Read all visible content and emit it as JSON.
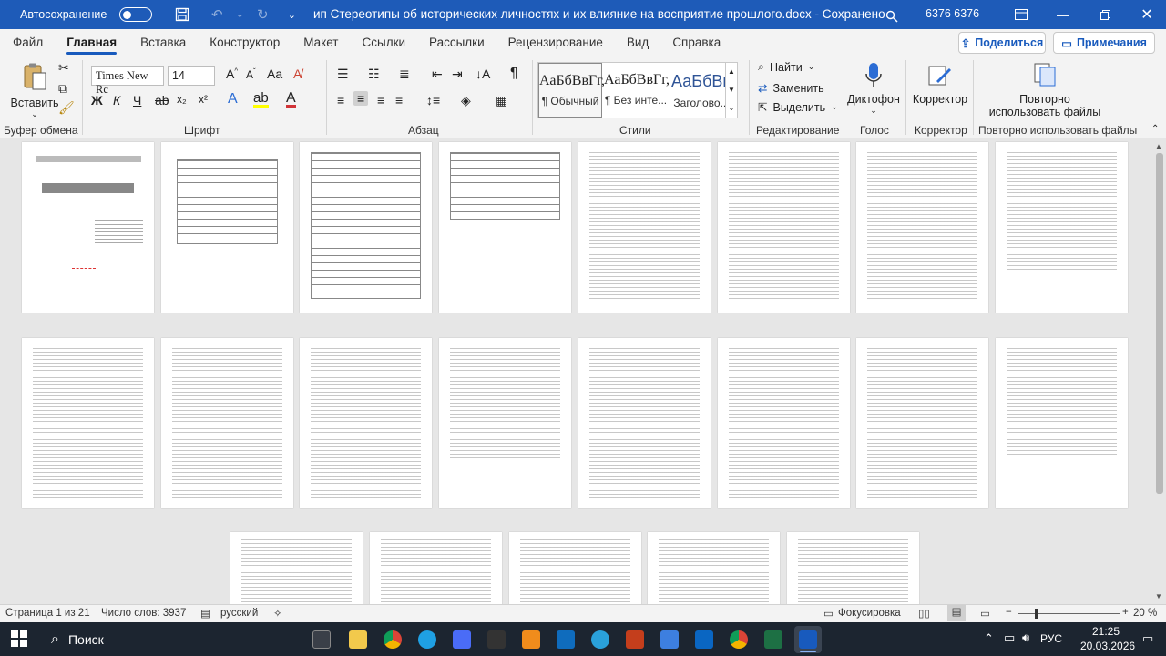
{
  "titlebar": {
    "autosave_label": "Автосохранение",
    "document_title": "ип Стереотипы об исторических личностях и их влияние на восприятие прошлого.docx  -  Сохранено",
    "user": "6376 6376"
  },
  "tabs": [
    "Файл",
    "Главная",
    "Вставка",
    "Конструктор",
    "Макет",
    "Ссылки",
    "Рассылки",
    "Рецензирование",
    "Вид",
    "Справка"
  ],
  "actions": {
    "share": "Поделиться",
    "notes": "Примечания"
  },
  "ribbon": {
    "paste_label": "Вставить",
    "font_name": "Times New Rc",
    "font_size": "14",
    "styles": [
      {
        "preview": "АаБбВвГг,",
        "name": "¶ Обычный"
      },
      {
        "preview": "АаБбВвГг,",
        "name": "¶ Без инте..."
      },
      {
        "preview": "АаБбВв",
        "name": "Заголово..."
      }
    ],
    "find": "Найти",
    "replace": "Заменить",
    "select": "Выделить",
    "dictation": "Диктофон",
    "editor": "Корректор",
    "reuse_line1": "Повторно",
    "reuse_line2": "использовать файлы",
    "groups": [
      "Буфер обмена",
      "Шрифт",
      "Абзац",
      "Стили",
      "Редактирование",
      "Голос",
      "Корректор",
      "Повторно использовать файлы"
    ]
  },
  "statusbar": {
    "page": "Страница 1 из 21",
    "words": "Число слов: 3937",
    "language": "русский",
    "focus": "Фокусировка",
    "zoom": "20 %",
    "zoom_level": 0.2
  },
  "taskbar": {
    "search": "Поиск",
    "lang": "РУС",
    "time": "21:25",
    "date": "20.03.2026"
  },
  "colors": {
    "accent": "#185abd",
    "titlebar": "#1e5bb8",
    "taskbar": "#1c2530"
  }
}
